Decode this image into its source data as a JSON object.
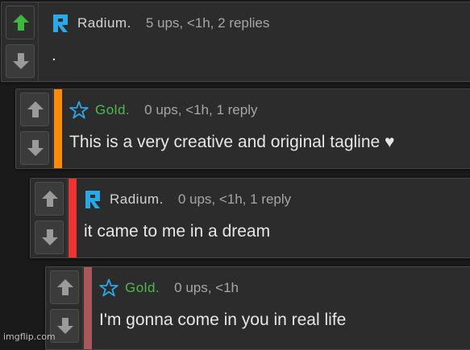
{
  "colors": {
    "background": "#1a1a1a",
    "card": "#2c2c2c",
    "upvote_active": "#3dba3d",
    "vote_arrow": "#9a9a9a",
    "radium_name": "#d4d4d4",
    "radium_icon": "#2aa8e8",
    "gold_name": "#4fb84f",
    "gold_icon": "#2aa8e8"
  },
  "comments": [
    {
      "username": "Radium.",
      "avatar_icon": "radium-r-icon",
      "meta": "5 ups, <1h, 2 replies",
      "text": ".",
      "stripe_color": "",
      "upvoted": true
    },
    {
      "username": "Gold.",
      "avatar_icon": "star-icon",
      "meta": "0 ups, <1h, 1 reply",
      "text": "This is a very creative and original tagline ♥",
      "stripe_color": "#ff8c00",
      "upvoted": false
    },
    {
      "username": "Radium.",
      "avatar_icon": "radium-r-icon",
      "meta": "0 ups, <1h, 1 reply",
      "text": "it came to me in a dream",
      "stripe_color": "#ee3333",
      "upvoted": false
    },
    {
      "username": "Gold.",
      "avatar_icon": "star-icon",
      "meta": "0 ups, <1h",
      "text": "I'm gonna come in you in real life",
      "stripe_color": "#a85858",
      "upvoted": false
    }
  ],
  "watermark": "imgflip.com"
}
